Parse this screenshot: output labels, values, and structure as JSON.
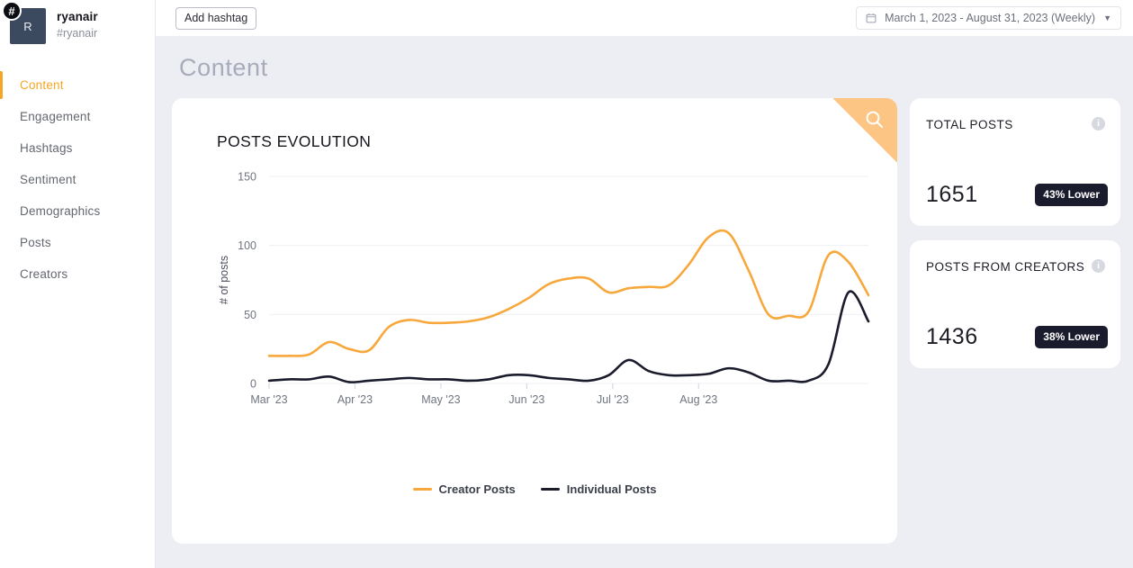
{
  "sidebar": {
    "brand": {
      "name": "ryanair",
      "handle": "#ryanair",
      "avatar_initial": "R",
      "badge_glyph": "#"
    },
    "items": [
      {
        "label": "Content",
        "active": true
      },
      {
        "label": "Engagement",
        "active": false
      },
      {
        "label": "Hashtags",
        "active": false
      },
      {
        "label": "Sentiment",
        "active": false
      },
      {
        "label": "Demographics",
        "active": false
      },
      {
        "label": "Posts",
        "active": false
      },
      {
        "label": "Creators",
        "active": false
      }
    ]
  },
  "topbar": {
    "add_hashtag_label": "Add hashtag",
    "date_range": "March 1, 2023 - August 31, 2023 (Weekly)",
    "calendar_icon": "calendar-icon",
    "caret_icon": "chevron-down-icon"
  },
  "page": {
    "title": "Content"
  },
  "chart_card": {
    "title": "POSTS EVOLUTION",
    "search_icon": "search-icon"
  },
  "metrics": [
    {
      "title": "TOTAL POSTS",
      "value": "1651",
      "badge": "43% Lower",
      "info_icon": "info-icon"
    },
    {
      "title": "POSTS FROM CREATORS",
      "value": "1436",
      "badge": "38% Lower",
      "info_icon": "info-icon"
    }
  ],
  "colors": {
    "accent_orange": "#f5a623",
    "line_creator": "#f7a83c",
    "line_individual": "#1b1b2e",
    "badge_bg": "#1b1b2e",
    "page_bg": "#eceef3",
    "ribbon": "#fcc583"
  },
  "chart_data": {
    "type": "line",
    "title": "POSTS EVOLUTION",
    "xlabel": "",
    "ylabel": "# of posts",
    "ylim": [
      0,
      150
    ],
    "yticks": [
      0,
      50,
      100,
      150
    ],
    "xticks": [
      "Mar '23",
      "Apr '23",
      "May '23",
      "Jun '23",
      "Jul '23",
      "Aug '23"
    ],
    "grid": true,
    "legend_position": "bottom",
    "x": [
      "Mar 5",
      "Mar 12",
      "Mar 19",
      "Mar 26",
      "Apr 2",
      "Apr 9",
      "Apr 16",
      "Apr 23",
      "Apr 30",
      "May 7",
      "May 14",
      "May 21",
      "May 28",
      "Jun 4",
      "Jun 11",
      "Jun 18",
      "Jun 25",
      "Jul 2",
      "Jul 9",
      "Jul 16",
      "Jul 23",
      "Jul 30",
      "Aug 6",
      "Aug 13",
      "Aug 20",
      "Aug 27",
      "Aug 31"
    ],
    "series": [
      {
        "name": "Creator Posts",
        "color": "#f7a83c",
        "values": [
          20,
          20,
          21,
          30,
          25,
          24,
          41,
          46,
          44,
          44,
          45,
          48,
          54,
          62,
          72,
          76,
          76,
          66,
          69,
          70,
          71,
          86,
          106,
          109,
          82,
          50,
          49,
          52,
          93,
          88,
          64
        ]
      },
      {
        "name": "Individual Posts",
        "color": "#1b1b2e",
        "values": [
          2,
          3,
          3,
          5,
          1,
          2,
          3,
          4,
          3,
          3,
          2,
          3,
          6,
          6,
          4,
          3,
          2,
          6,
          17,
          9,
          6,
          6,
          7,
          11,
          8,
          2,
          2,
          2,
          14,
          66,
          45
        ]
      }
    ]
  }
}
